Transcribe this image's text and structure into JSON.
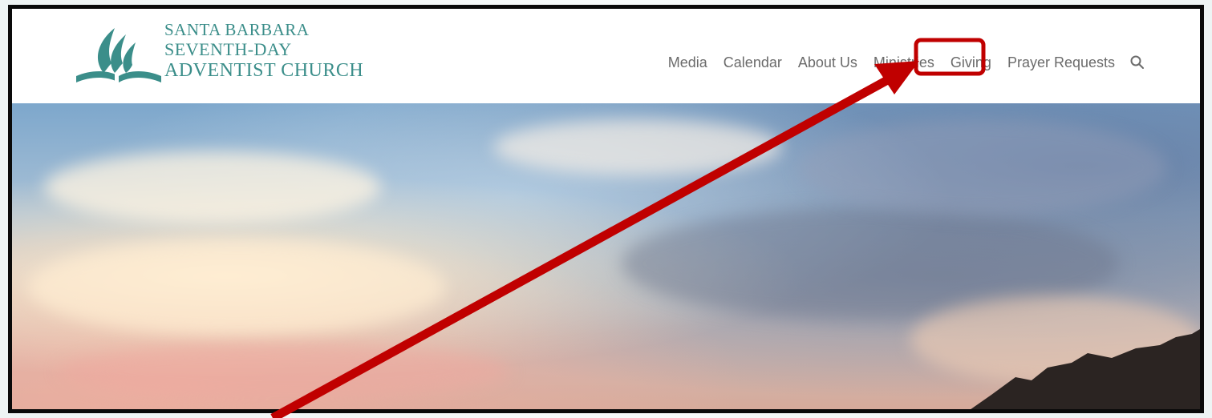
{
  "logo": {
    "line1": "Santa Barbara",
    "line2": "Seventh-day",
    "line3": "Adventist Church"
  },
  "nav": {
    "items": [
      {
        "label": "Media"
      },
      {
        "label": "Calendar"
      },
      {
        "label": "About Us"
      },
      {
        "label": "Ministries"
      },
      {
        "label": "Giving"
      },
      {
        "label": "Prayer Requests"
      }
    ],
    "search_icon": "search-icon"
  },
  "annotation": {
    "arrow_color": "#c00000",
    "highlight_box_color": "#c00000"
  },
  "colors": {
    "logo_teal": "#3b8e8a",
    "nav_text": "#6b6b6b"
  }
}
